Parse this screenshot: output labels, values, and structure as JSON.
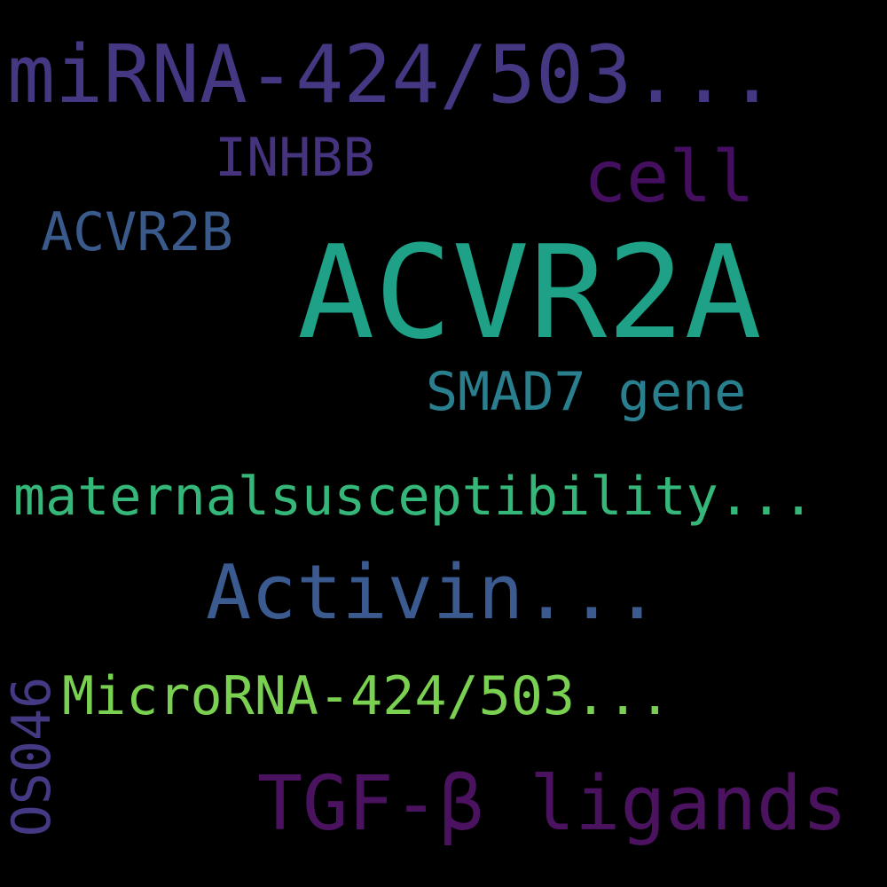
{
  "word_cloud": {
    "background": "#000000",
    "words": {
      "mirna": {
        "text": "miRNA-424/503...",
        "color": "#453781"
      },
      "inhbb": {
        "text": "INHBB",
        "color": "#46337e"
      },
      "cell": {
        "text": "cell",
        "color": "#440f5f"
      },
      "acvr2b": {
        "text": "ACVR2B",
        "color": "#3b5a8c"
      },
      "acvr2a": {
        "text": "ACVR2A",
        "color": "#1fa187"
      },
      "smad7": {
        "text": "SMAD7 gene",
        "color": "#2a7f8e"
      },
      "maternal": {
        "text": "maternalsusceptibility...",
        "color": "#35b779"
      },
      "activin": {
        "text": "Activin...",
        "color": "#3b5a8f"
      },
      "microrna": {
        "text": "MicroRNA-424/503...",
        "color": "#7ad151"
      },
      "tgfb": {
        "text": "TGF-β ligands",
        "color": "#4b125f"
      },
      "os046": {
        "text": "OS046",
        "color": "#433a83"
      }
    }
  }
}
